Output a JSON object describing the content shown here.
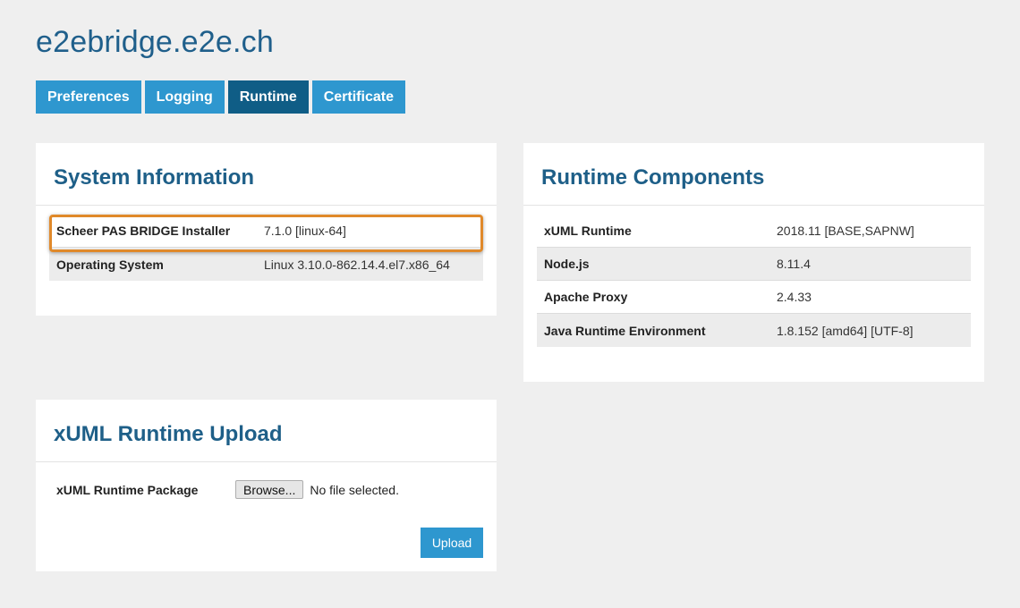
{
  "header": {
    "host": "e2ebridge.e2e.ch"
  },
  "tabs": [
    {
      "label": "Preferences"
    },
    {
      "label": "Logging"
    },
    {
      "label": "Runtime"
    },
    {
      "label": "Certificate"
    }
  ],
  "system_info": {
    "title": "System Information",
    "rows": [
      {
        "key": "Scheer PAS BRIDGE Installer",
        "value": "7.1.0 [linux-64]"
      },
      {
        "key": "Operating System",
        "value": "Linux 3.10.0-862.14.4.el7.x86_64"
      }
    ]
  },
  "runtime_components": {
    "title": "Runtime Components",
    "rows": [
      {
        "key": "xUML Runtime",
        "value": "2018.11 [BASE,SAPNW]"
      },
      {
        "key": "Node.js",
        "value": "8.11.4"
      },
      {
        "key": "Apache Proxy",
        "value": "2.4.33"
      },
      {
        "key": "Java Runtime Environment",
        "value": "1.8.152 [amd64] [UTF-8]"
      }
    ]
  },
  "upload": {
    "title": "xUML Runtime Upload",
    "field_label": "xUML Runtime Package",
    "browse_label": "Browse...",
    "no_file_text": "No file selected.",
    "upload_label": "Upload"
  },
  "colors": {
    "accent": "#2e97cf",
    "active_tab": "#0f5d86",
    "heading": "#1e5f88",
    "highlight": "#e0892a"
  }
}
